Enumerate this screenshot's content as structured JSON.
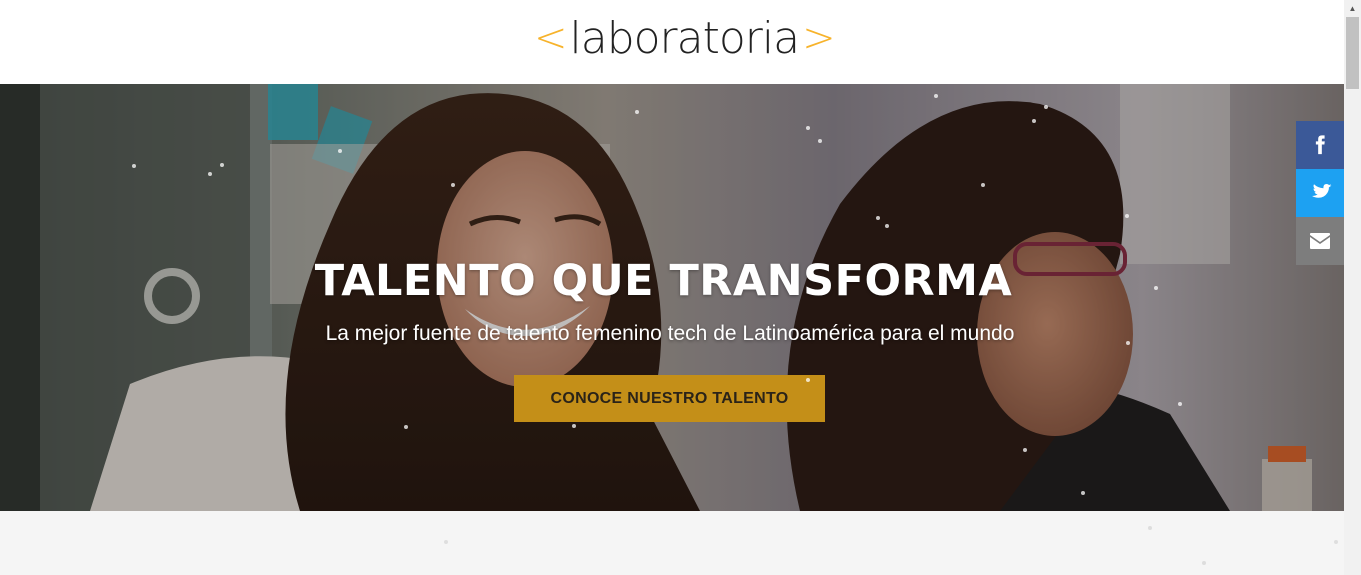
{
  "header": {
    "logo": {
      "bracket_left": "<",
      "word": "laboratoria",
      "bracket_right": ">",
      "accent_color": "#f7b32b"
    }
  },
  "hero": {
    "title": "TALENTO QUE TRANSFORMA",
    "subtitle": "La mejor fuente de talento femenino tech de Latinoamérica para el mundo",
    "cta_label": "CONOCE NUESTRO TALENTO",
    "cta_color": "#c48f18"
  },
  "social": {
    "items": [
      {
        "icon": "facebook-icon",
        "color": "#3b5998"
      },
      {
        "icon": "twitter-icon",
        "color": "#1da1f2"
      },
      {
        "icon": "email-icon",
        "color": "#7d7d7d"
      }
    ]
  }
}
